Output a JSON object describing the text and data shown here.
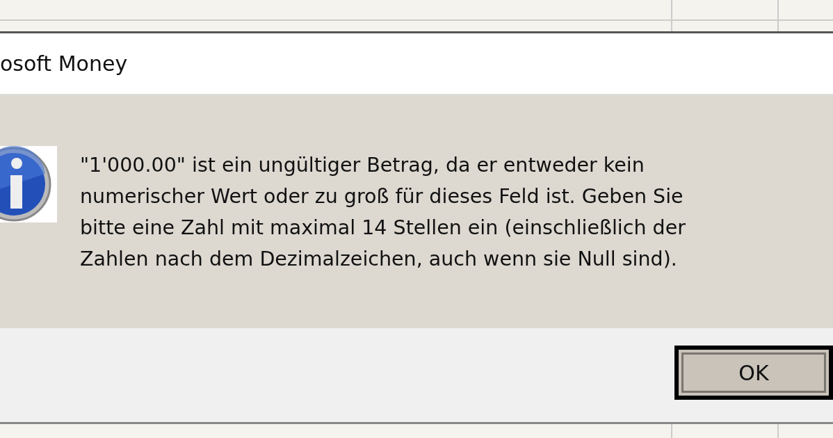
{
  "window": {
    "title": "osoft Money"
  },
  "message": "\"1'000.00\" ist ein ungültiger Betrag, da er entweder kein\nnumerischer Wert oder zu groß für dieses Feld ist. Geben Sie\nbitte eine Zahl mit maximal 14 Stellen ein (einschließlich der\nZahlen nach dem Dezimalzeichen, auch wenn sie Null sind).",
  "buttons": [
    {
      "label": "OK",
      "default": true
    }
  ]
}
